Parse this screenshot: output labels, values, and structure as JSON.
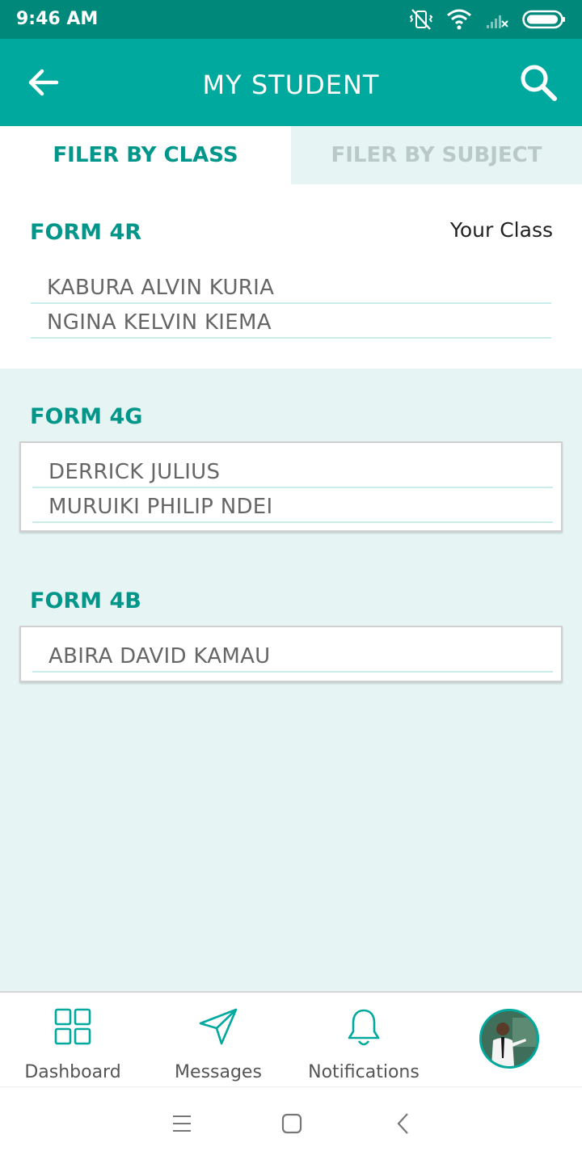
{
  "status": {
    "time": "9:46 AM",
    "icons": [
      "vibrate-off-icon",
      "wifi-icon",
      "signal-off-icon",
      "battery-icon"
    ]
  },
  "header": {
    "title": "MY STUDENT",
    "back_icon": "arrow-left-icon",
    "search_icon": "search-icon"
  },
  "tabs": [
    {
      "label": "FILER BY CLASS",
      "active": true
    },
    {
      "label": "FILER BY SUBJECT",
      "active": false
    }
  ],
  "classes": [
    {
      "name": "FORM 4R",
      "tag": "Your Class",
      "students": [
        "KABURA ALVIN KURIA",
        "NGINA KELVIN KIEMA"
      ]
    },
    {
      "name": "FORM 4G",
      "students": [
        "DERRICK JULIUS",
        "MURUIKI PHILIP NDEI"
      ]
    },
    {
      "name": "FORM 4B",
      "students": [
        "ABIRA DAVID KAMAU"
      ]
    }
  ],
  "bottom_nav": [
    {
      "label": "Dashboard",
      "icon": "dashboard-grid-icon"
    },
    {
      "label": "Messages",
      "icon": "send-icon"
    },
    {
      "label": "Notifications",
      "icon": "bell-icon"
    },
    {
      "label": "",
      "icon": "profile-avatar"
    }
  ],
  "system_nav": [
    "menu-icon",
    "home-square-icon",
    "back-chevron-icon"
  ],
  "colors": {
    "status_bar": "#00897b",
    "primary": "#00a99d",
    "accent_text": "#00968a",
    "background": "#e6f5f4"
  }
}
